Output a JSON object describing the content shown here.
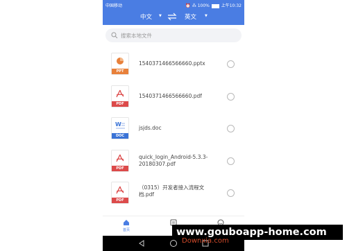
{
  "status_bar": {
    "carrier": "中国移动",
    "right_text": "⏰ ⁂ 100% ",
    "time": "上午10:32"
  },
  "header": {
    "source_language": "中文",
    "target_language": "英文"
  },
  "search": {
    "placeholder": "搜索本地文件"
  },
  "files": [
    {
      "name": "1540371466566660.pptx",
      "type_label": "PPT",
      "color": "#e8803a"
    },
    {
      "name": "1540371466566660.pdf",
      "type_label": "PDF",
      "color": "#dc4a4a"
    },
    {
      "name": "jsjds.doc",
      "type_label": "DOC",
      "color": "#3a73d6"
    },
    {
      "name": "quick_login_Android-5.3.3-20180307.pdf",
      "type_label": "PDF",
      "color": "#dc4a4a"
    },
    {
      "name": "（0315）开发者接入流程文档.pdf",
      "type_label": "PDF",
      "color": "#dc4a4a"
    }
  ],
  "tabs": [
    {
      "label": "首页",
      "icon": "home-icon",
      "active": true
    },
    {
      "label": "",
      "icon": "document-icon",
      "active": false
    },
    {
      "label": "",
      "icon": "smiley-icon",
      "active": false
    }
  ],
  "watermark": {
    "main": "www.gouboapp-home.com",
    "sub": "Downxia.com"
  },
  "colors": {
    "accent": "#4a7de3",
    "pdf": "#dc4a4a",
    "ppt": "#e8803a",
    "doc": "#3a73d6"
  }
}
